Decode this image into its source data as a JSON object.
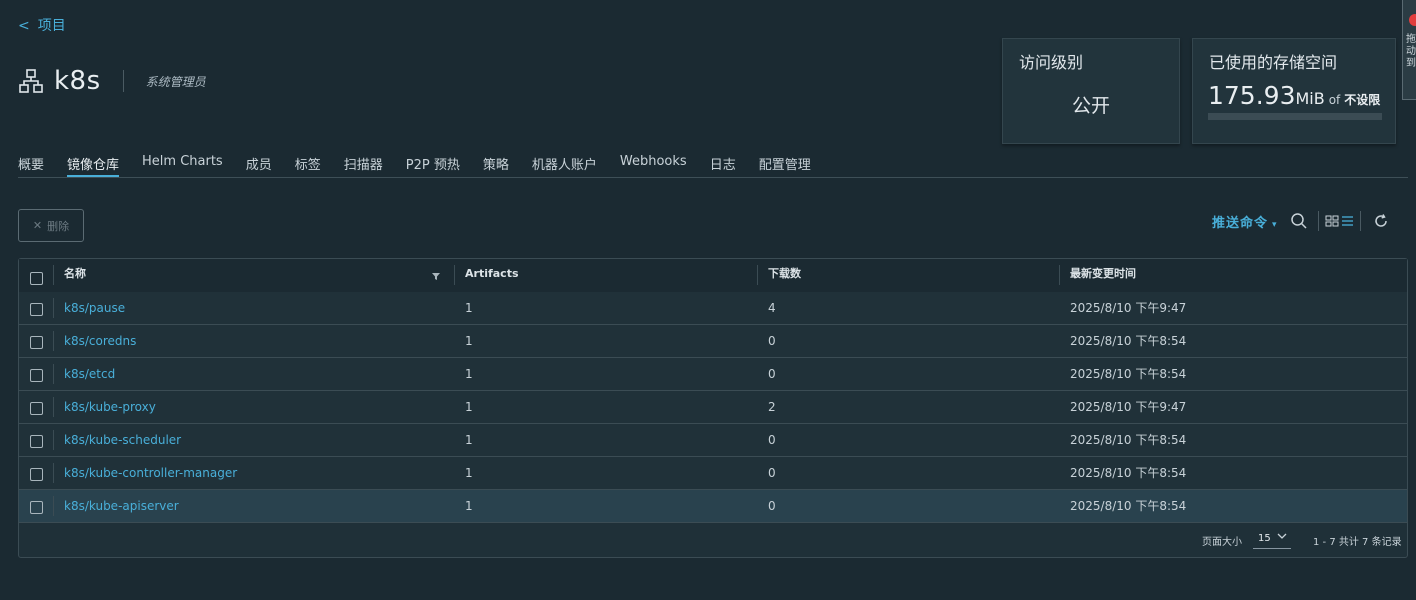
{
  "nav": {
    "back_label": "项目"
  },
  "project": {
    "name": "k8s",
    "role": "系统管理员"
  },
  "cards": {
    "access": {
      "title": "访问级别",
      "value": "公开"
    },
    "storage": {
      "title": "已使用的存储空间",
      "value": "175.93",
      "unit": "MiB",
      "of": "of",
      "limit": "不设限",
      "used_fraction": 0
    }
  },
  "side_strip": {
    "text": "拖动到"
  },
  "tabs": [
    "概要",
    "镜像仓库",
    "Helm Charts",
    "成员",
    "标签",
    "扫描器",
    "P2P 预热",
    "策略",
    "机器人账户",
    "Webhooks",
    "日志",
    "配置管理"
  ],
  "active_tab": 1,
  "toolbar": {
    "delete_label": "删除",
    "push_command_label": "推送命令"
  },
  "table": {
    "columns": [
      "名称",
      "Artifacts",
      "下载数",
      "最新变更时间"
    ],
    "rows": [
      {
        "name": "k8s/pause",
        "artifacts": "1",
        "downloads": "4",
        "updated": "2025/8/10 下午9:47"
      },
      {
        "name": "k8s/coredns",
        "artifacts": "1",
        "downloads": "0",
        "updated": "2025/8/10 下午8:54"
      },
      {
        "name": "k8s/etcd",
        "artifacts": "1",
        "downloads": "0",
        "updated": "2025/8/10 下午8:54"
      },
      {
        "name": "k8s/kube-proxy",
        "artifacts": "1",
        "downloads": "2",
        "updated": "2025/8/10 下午9:47"
      },
      {
        "name": "k8s/kube-scheduler",
        "artifacts": "1",
        "downloads": "0",
        "updated": "2025/8/10 下午8:54"
      },
      {
        "name": "k8s/kube-controller-manager",
        "artifacts": "1",
        "downloads": "0",
        "updated": "2025/8/10 下午8:54"
      },
      {
        "name": "k8s/kube-apiserver",
        "artifacts": "1",
        "downloads": "0",
        "updated": "2025/8/10 下午8:54"
      }
    ]
  },
  "pagination": {
    "page_size_label": "页面大小",
    "page_size": "15",
    "summary": "1 - 7 共计 7 条记录"
  },
  "colors": {
    "accent": "#49afd9",
    "background": "#1b2a32",
    "card": "#22343c"
  }
}
